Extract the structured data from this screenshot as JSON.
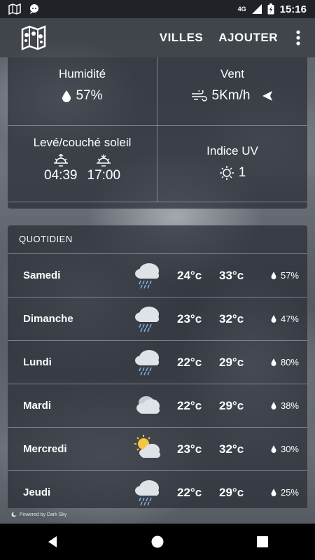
{
  "status_bar": {
    "time": "15:16",
    "network": "4G",
    "left_icons": [
      "map-icon",
      "chat-icon"
    ],
    "right_icons": [
      "signal-icon",
      "battery-charging-icon"
    ]
  },
  "app_bar": {
    "logo": "map-logo-icon",
    "actions": {
      "cities": "VILLES",
      "add": "AJOUTER"
    },
    "overflow": "more-vert-icon"
  },
  "stats": {
    "humidity": {
      "title": "Humidité",
      "value": "57%"
    },
    "wind": {
      "title": "Vent",
      "value": "5Km/h"
    },
    "sun": {
      "title": "Levé/couché soleil",
      "sunrise": "04:39",
      "sunset": "17:00"
    },
    "uv": {
      "title": "Indice UV",
      "value": "1"
    }
  },
  "daily": {
    "header": "QUOTIDIEN",
    "days": [
      {
        "name": "Samedi",
        "icon": "rain-cloud-icon",
        "min": "24°c",
        "max": "33°c",
        "rain": "57%"
      },
      {
        "name": "Dimanche",
        "icon": "rain-cloud-icon",
        "min": "23°c",
        "max": "32°c",
        "rain": "47%"
      },
      {
        "name": "Lundi",
        "icon": "rain-cloud-icon",
        "min": "22°c",
        "max": "29°c",
        "rain": "80%"
      },
      {
        "name": "Mardi",
        "icon": "cloud-icon",
        "min": "22°c",
        "max": "29°c",
        "rain": "38%"
      },
      {
        "name": "Mercredi",
        "icon": "partly-cloudy-icon",
        "min": "23°c",
        "max": "32°c",
        "rain": "30%"
      },
      {
        "name": "Jeudi",
        "icon": "rain-cloud-icon",
        "min": "22°c",
        "max": "29°c",
        "rain": "25%"
      }
    ]
  },
  "footer": {
    "powered": "Powered by Dark Sky"
  },
  "colors": {
    "sun": "#f5c542",
    "cloud": "#dfe3e8",
    "rain": "#7fb4e6",
    "statusbar": "#1f2226"
  }
}
